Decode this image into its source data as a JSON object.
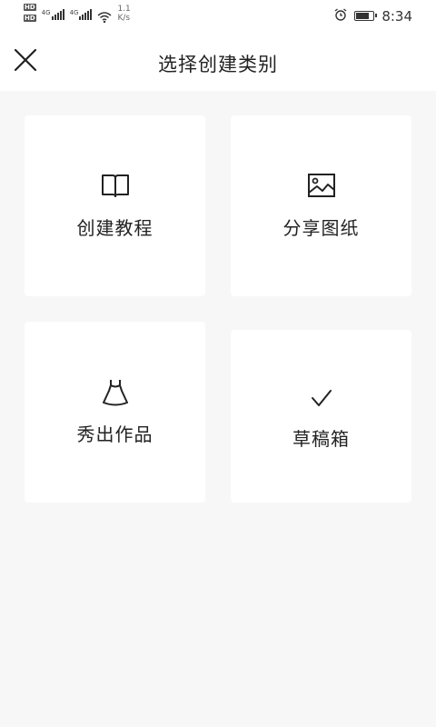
{
  "status_bar": {
    "hd_badges": [
      "HD",
      "HD"
    ],
    "network_1": "4G",
    "network_2": "4G",
    "speed_value": "1.1",
    "speed_unit": "K/s",
    "time": "8:34",
    "battery_level": 0.8
  },
  "header": {
    "title": "选择创建类别",
    "close_icon": "close-icon"
  },
  "options": [
    {
      "label": "创建教程",
      "icon": "book-icon"
    },
    {
      "label": "分享图纸",
      "icon": "image-icon"
    },
    {
      "label": "秀出作品",
      "icon": "dress-icon"
    },
    {
      "label": "草稿箱",
      "icon": "check-icon"
    }
  ],
  "colors": {
    "background": "#f7f7f7",
    "card": "#ffffff",
    "text": "#222222"
  }
}
